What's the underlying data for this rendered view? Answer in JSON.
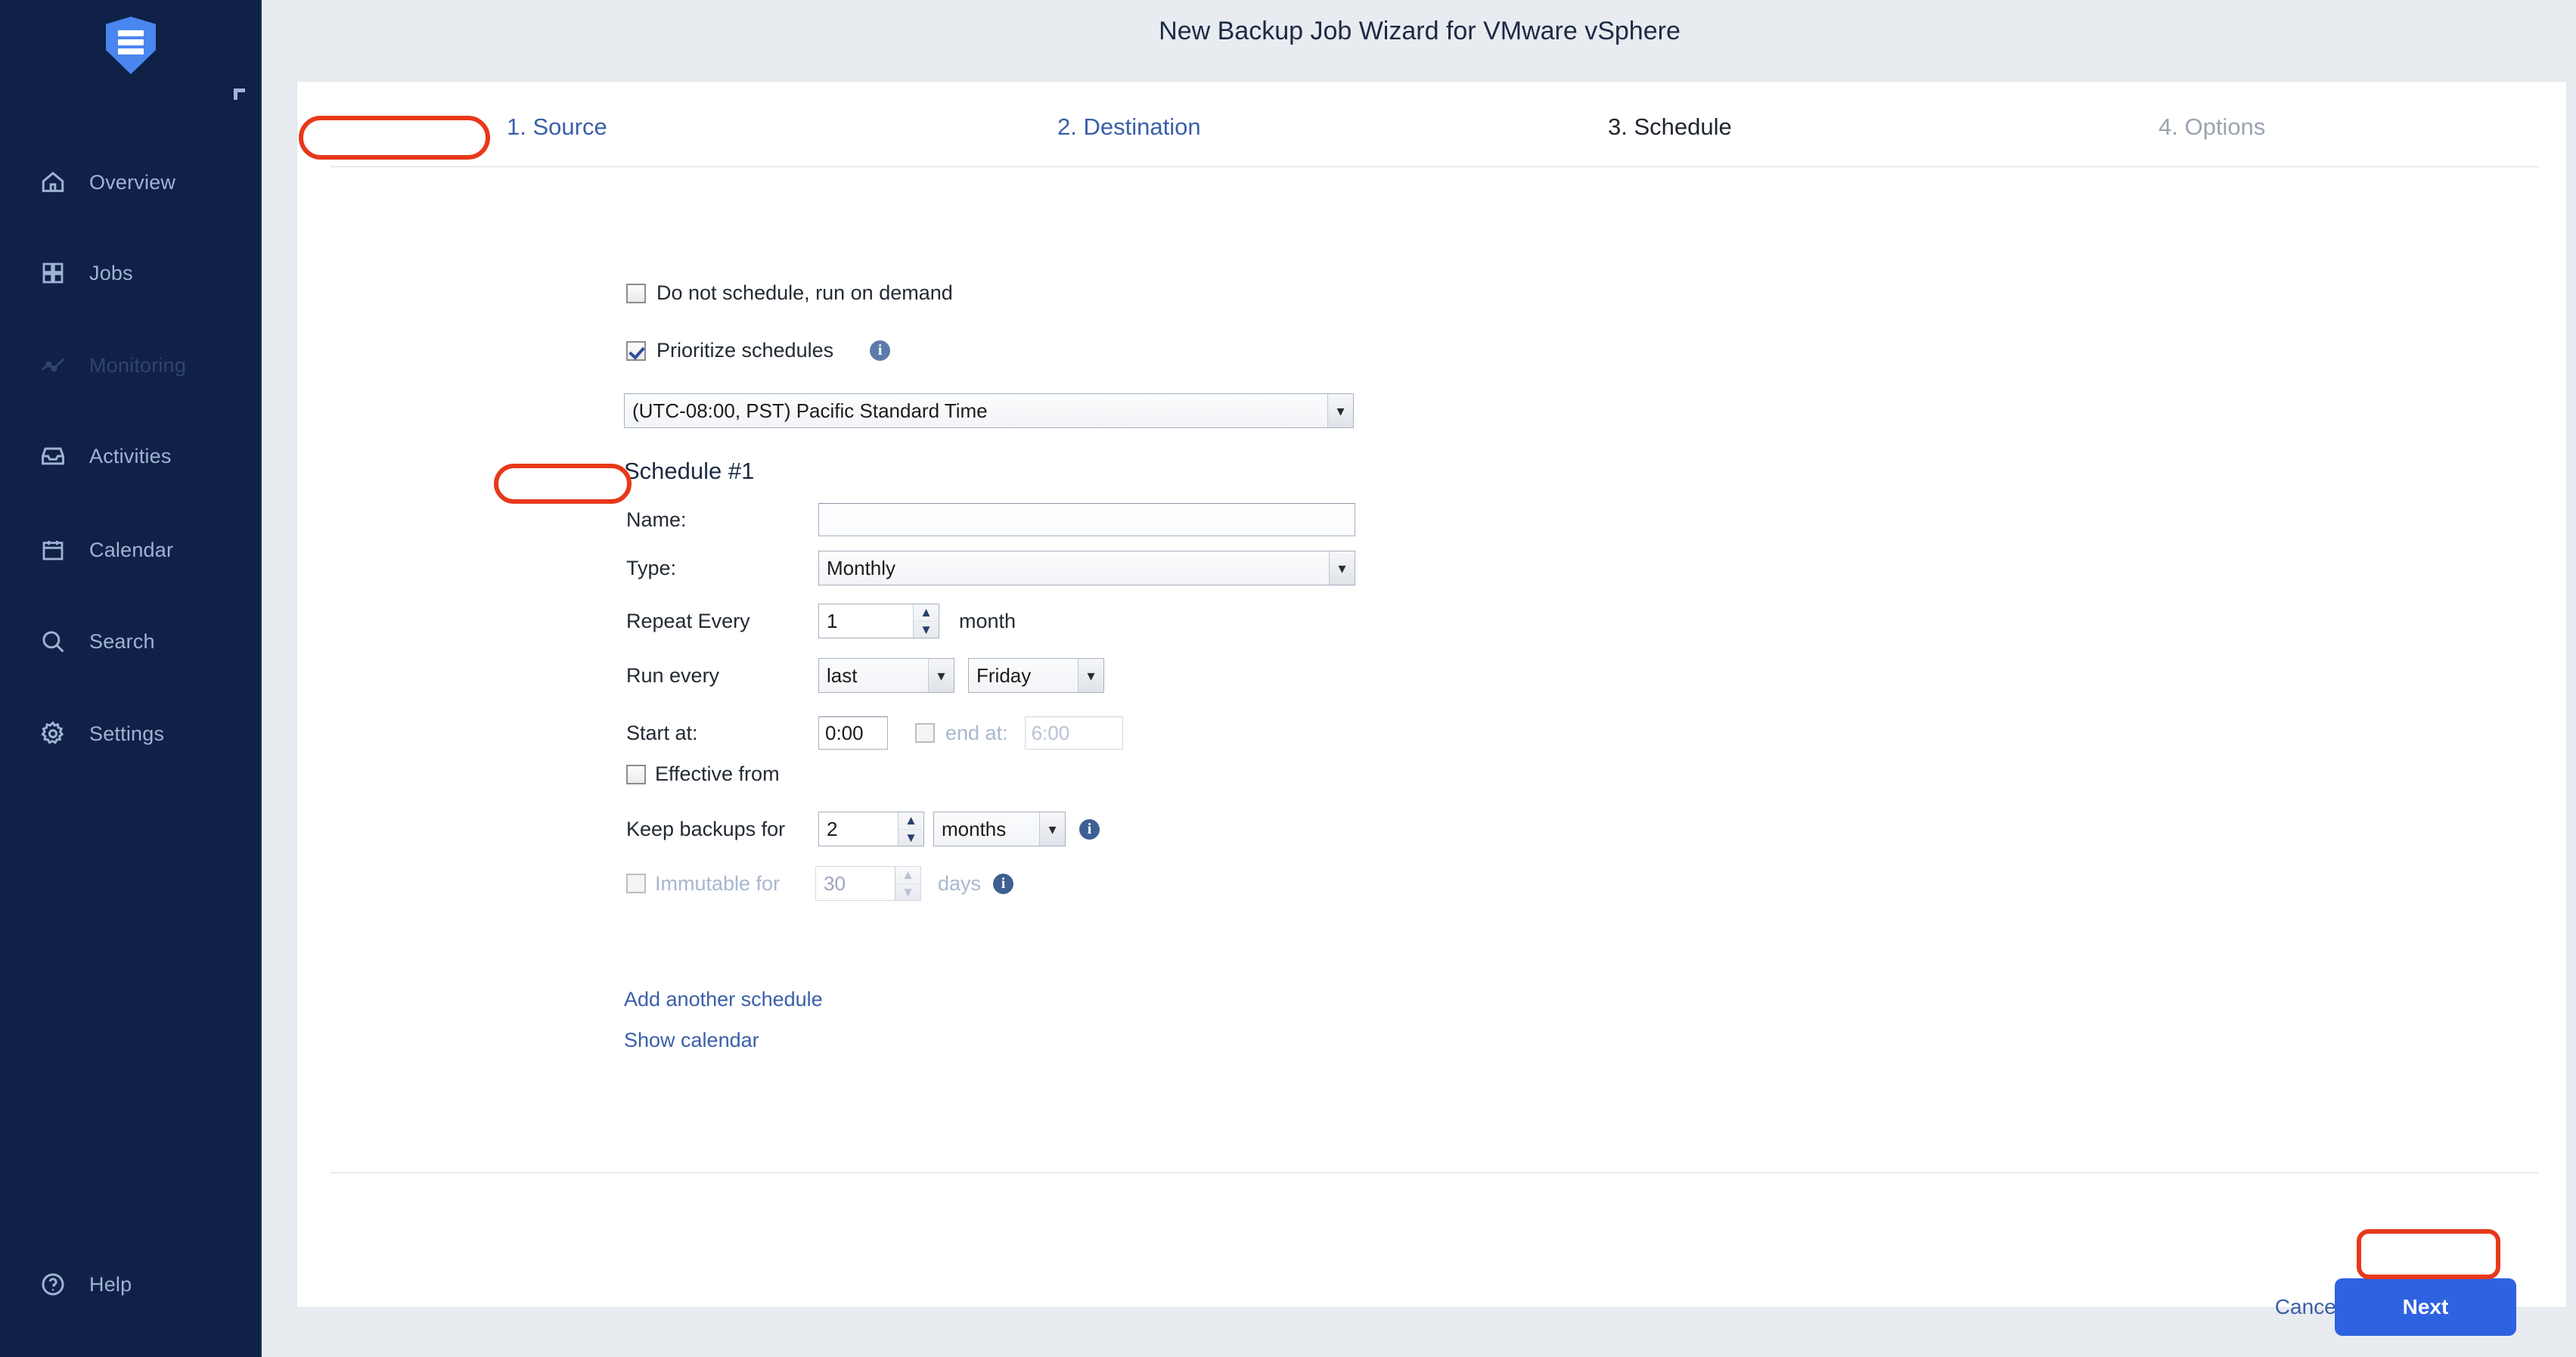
{
  "app": {
    "logo_icon": "shield-logo-icon",
    "collapse_icon": "corner-collapse-icon"
  },
  "sidebar": {
    "items": [
      {
        "label": "Overview",
        "icon": "home-icon",
        "state": "normal"
      },
      {
        "label": "Jobs",
        "icon": "grid-icon",
        "state": "normal"
      },
      {
        "label": "Monitoring",
        "icon": "line-chart-icon",
        "state": "dimmed"
      },
      {
        "label": "Activities",
        "icon": "inbox-icon",
        "state": "normal"
      },
      {
        "label": "Calendar",
        "icon": "calendar-icon",
        "state": "normal"
      },
      {
        "label": "Search",
        "icon": "search-icon",
        "state": "normal"
      },
      {
        "label": "Settings",
        "icon": "gear-icon",
        "state": "normal"
      }
    ],
    "help": {
      "label": "Help",
      "icon": "question-circle-icon"
    }
  },
  "header": {
    "title": "New Backup Job Wizard for VMware vSphere"
  },
  "tabs": [
    {
      "label": "1. Source",
      "state": "done"
    },
    {
      "label": "2. Destination",
      "state": "done"
    },
    {
      "label": "3. Schedule",
      "state": "current"
    },
    {
      "label": "4. Options",
      "state": "disabled"
    }
  ],
  "form": {
    "do_not_schedule": {
      "label": "Do not schedule, run on demand",
      "checked": false
    },
    "prioritize": {
      "label": "Prioritize schedules",
      "checked": true,
      "info_icon": "info-icon"
    },
    "timezone": {
      "value": "(UTC-08:00, PST) Pacific Standard Time"
    },
    "schedule_title": "Schedule #1",
    "name": {
      "label": "Name:",
      "value": "",
      "placeholder": ""
    },
    "type": {
      "label": "Type:",
      "value": "Monthly"
    },
    "repeat_every": {
      "label": "Repeat Every",
      "value": "1",
      "unit": "month"
    },
    "run_every": {
      "label": "Run every",
      "ordinal": "last",
      "weekday": "Friday"
    },
    "start_at": {
      "label": "Start at:",
      "value": "0:00",
      "end_label": "end at:",
      "end_value": "6:00",
      "end_checked": false,
      "end_enabled": false
    },
    "effective_from": {
      "label": "Effective from",
      "checked": false
    },
    "keep_backups": {
      "label": "Keep backups for",
      "value": "2",
      "unit": "months",
      "info_icon": "info-icon"
    },
    "immutable": {
      "label": "Immutable for",
      "value": "30",
      "unit": "days",
      "checked": false,
      "enabled": false,
      "info_icon": "info-icon"
    },
    "add_another": "Add another schedule",
    "show_calendar": "Show calendar"
  },
  "footer": {
    "cancel_label": "Cancel",
    "next_label": "Next"
  },
  "icons": {
    "chevron_down": "▾",
    "caret_up": "▲",
    "caret_down": "▼",
    "info": "i"
  },
  "colors": {
    "sidebar_bg": "#0f2147",
    "brand_blue": "#4a86f0",
    "accent_blue": "#2f62e0",
    "link_blue": "#3a5fa8",
    "highlight_red": "#e8381b",
    "panel_bg": "#ffffff",
    "page_bg": "#e8ebf0"
  }
}
